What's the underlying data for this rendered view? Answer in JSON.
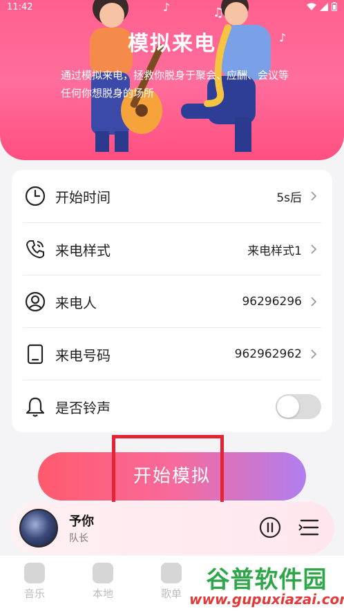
{
  "status_bar": {
    "time": "11:42"
  },
  "hero": {
    "title": "模拟来电",
    "description": "通过模拟来电，拯救你脱身于聚会、应酬、会议等任何你想脱身的场所"
  },
  "settings": {
    "start_time": {
      "label": "开始时间",
      "value": "5s后",
      "icon": "clock-icon"
    },
    "call_style": {
      "label": "来电样式",
      "value": "来电样式1",
      "icon": "phone-call-icon"
    },
    "caller": {
      "label": "来电人",
      "value": "96296296",
      "icon": "person-icon"
    },
    "caller_number": {
      "label": "来电号码",
      "value": "962962962",
      "icon": "tablet-icon"
    },
    "ringtone": {
      "label": "是否铃声",
      "enabled": false,
      "icon": "bell-icon"
    }
  },
  "start_button": {
    "label": "开始模拟"
  },
  "player": {
    "title": "予你",
    "artist": "队长"
  },
  "tabs": [
    {
      "label": "音乐"
    },
    {
      "label": "本地"
    },
    {
      "label": "歌单"
    }
  ],
  "watermark": {
    "text": "谷普软件园",
    "url": "www.gupuxiazai.com"
  },
  "colors": {
    "hero": "#ff5f8e",
    "highlight": "#e52433",
    "button_start": "#ff5a6e",
    "button_end": "#b07ff0"
  }
}
